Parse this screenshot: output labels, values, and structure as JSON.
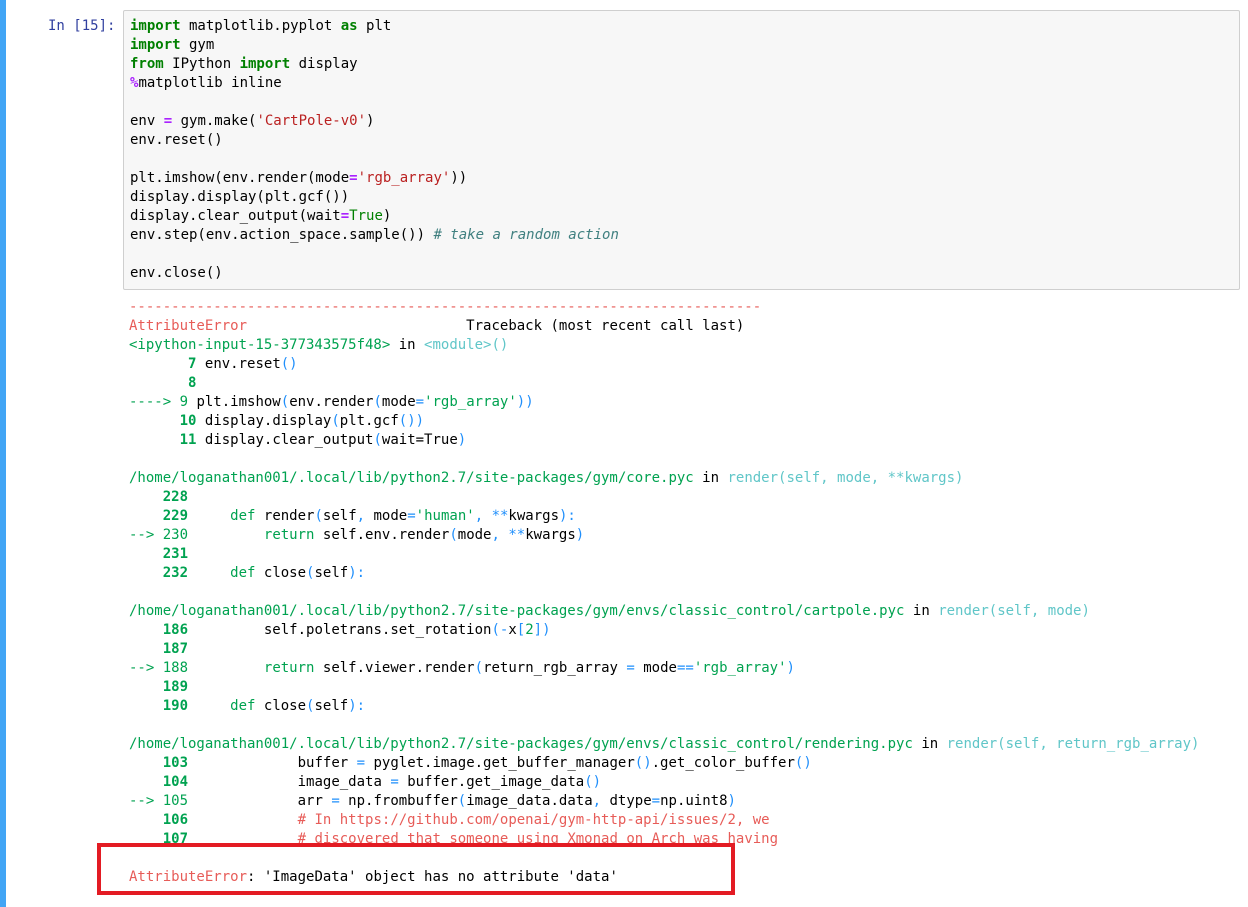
{
  "cell": {
    "prompt": "In [15]:",
    "code_lines": [
      "import matplotlib.pyplot as plt",
      "import gym",
      "from IPython import display",
      "%matplotlib inline",
      "",
      "env = gym.make('CartPole-v0')",
      "env.reset()",
      "",
      "plt.imshow(env.render(mode='rgb_array'))",
      "display.display(plt.gcf())",
      "display.clear_output(wait=True)",
      "env.step(env.action_space.sample()) # take a random action",
      "",
      "env.close()"
    ]
  },
  "traceback": {
    "separator": "---------------------------------------------------------------------------",
    "error_type": "AttributeError",
    "header_label": "Traceback (most recent call last)",
    "frames": [
      {
        "location": "<ipython-input-15-377343575f48>",
        "in_word": "in",
        "function": "<module>()",
        "lines": [
          {
            "marker": "",
            "number": "7",
            "code": "env.reset()"
          },
          {
            "marker": "",
            "number": "8",
            "code": ""
          },
          {
            "marker": "---->",
            "number": "9",
            "code": "plt.imshow(env.render(mode='rgb_array'))"
          },
          {
            "marker": "",
            "number": "10",
            "code": "display.display(plt.gcf())"
          },
          {
            "marker": "",
            "number": "11",
            "code": "display.clear_output(wait=True)"
          }
        ]
      },
      {
        "location": "/home/loganathan001/.local/lib/python2.7/site-packages/gym/core.pyc",
        "in_word": "in",
        "function": "render(self, mode, **kwargs)",
        "lines": [
          {
            "marker": "",
            "number": "228",
            "code": ""
          },
          {
            "marker": "",
            "number": "229",
            "code": "    def render(self, mode='human', **kwargs):"
          },
          {
            "marker": "-->",
            "number": "230",
            "code": "        return self.env.render(mode, **kwargs)"
          },
          {
            "marker": "",
            "number": "231",
            "code": ""
          },
          {
            "marker": "",
            "number": "232",
            "code": "    def close(self):"
          }
        ]
      },
      {
        "location": "/home/loganathan001/.local/lib/python2.7/site-packages/gym/envs/classic_control/cartpole.pyc",
        "in_word": "in",
        "function": "render(self, mode)",
        "lines": [
          {
            "marker": "",
            "number": "186",
            "code": "        self.poletrans.set_rotation(-x[2])"
          },
          {
            "marker": "",
            "number": "187",
            "code": ""
          },
          {
            "marker": "-->",
            "number": "188",
            "code": "        return self.viewer.render(return_rgb_array = mode=='rgb_array')"
          },
          {
            "marker": "",
            "number": "189",
            "code": ""
          },
          {
            "marker": "",
            "number": "190",
            "code": "    def close(self):"
          }
        ]
      },
      {
        "location": "/home/loganathan001/.local/lib/python2.7/site-packages/gym/envs/classic_control/rendering.pyc",
        "in_word": "in",
        "function": "render(self, return_rgb_array)",
        "lines": [
          {
            "marker": "",
            "number": "103",
            "code": "            buffer = pyglet.image.get_buffer_manager().get_color_buffer()"
          },
          {
            "marker": "",
            "number": "104",
            "code": "            image_data = buffer.get_image_data()"
          },
          {
            "marker": "-->",
            "number": "105",
            "code": "            arr = np.frombuffer(image_data.data, dtype=np.uint8)"
          },
          {
            "marker": "",
            "number": "106",
            "code": "            # In https://github.com/openai/gym-http-api/issues/2, we"
          },
          {
            "marker": "",
            "number": "107",
            "code": "            # discovered that someone using Xmonad on Arch was having"
          }
        ]
      }
    ],
    "final_error_type": "AttributeError",
    "final_error_message": ": 'ImageData' object has no attribute 'data'"
  },
  "colors": {
    "selected_cell_bar": "#42a5f5",
    "prompt": "#303f9f",
    "input_background": "#f7f7f7",
    "error_red": "#e75c58",
    "frame_green": "#00a250",
    "function_cyan": "#60c6c8",
    "highlight_box": "#e31b23"
  }
}
